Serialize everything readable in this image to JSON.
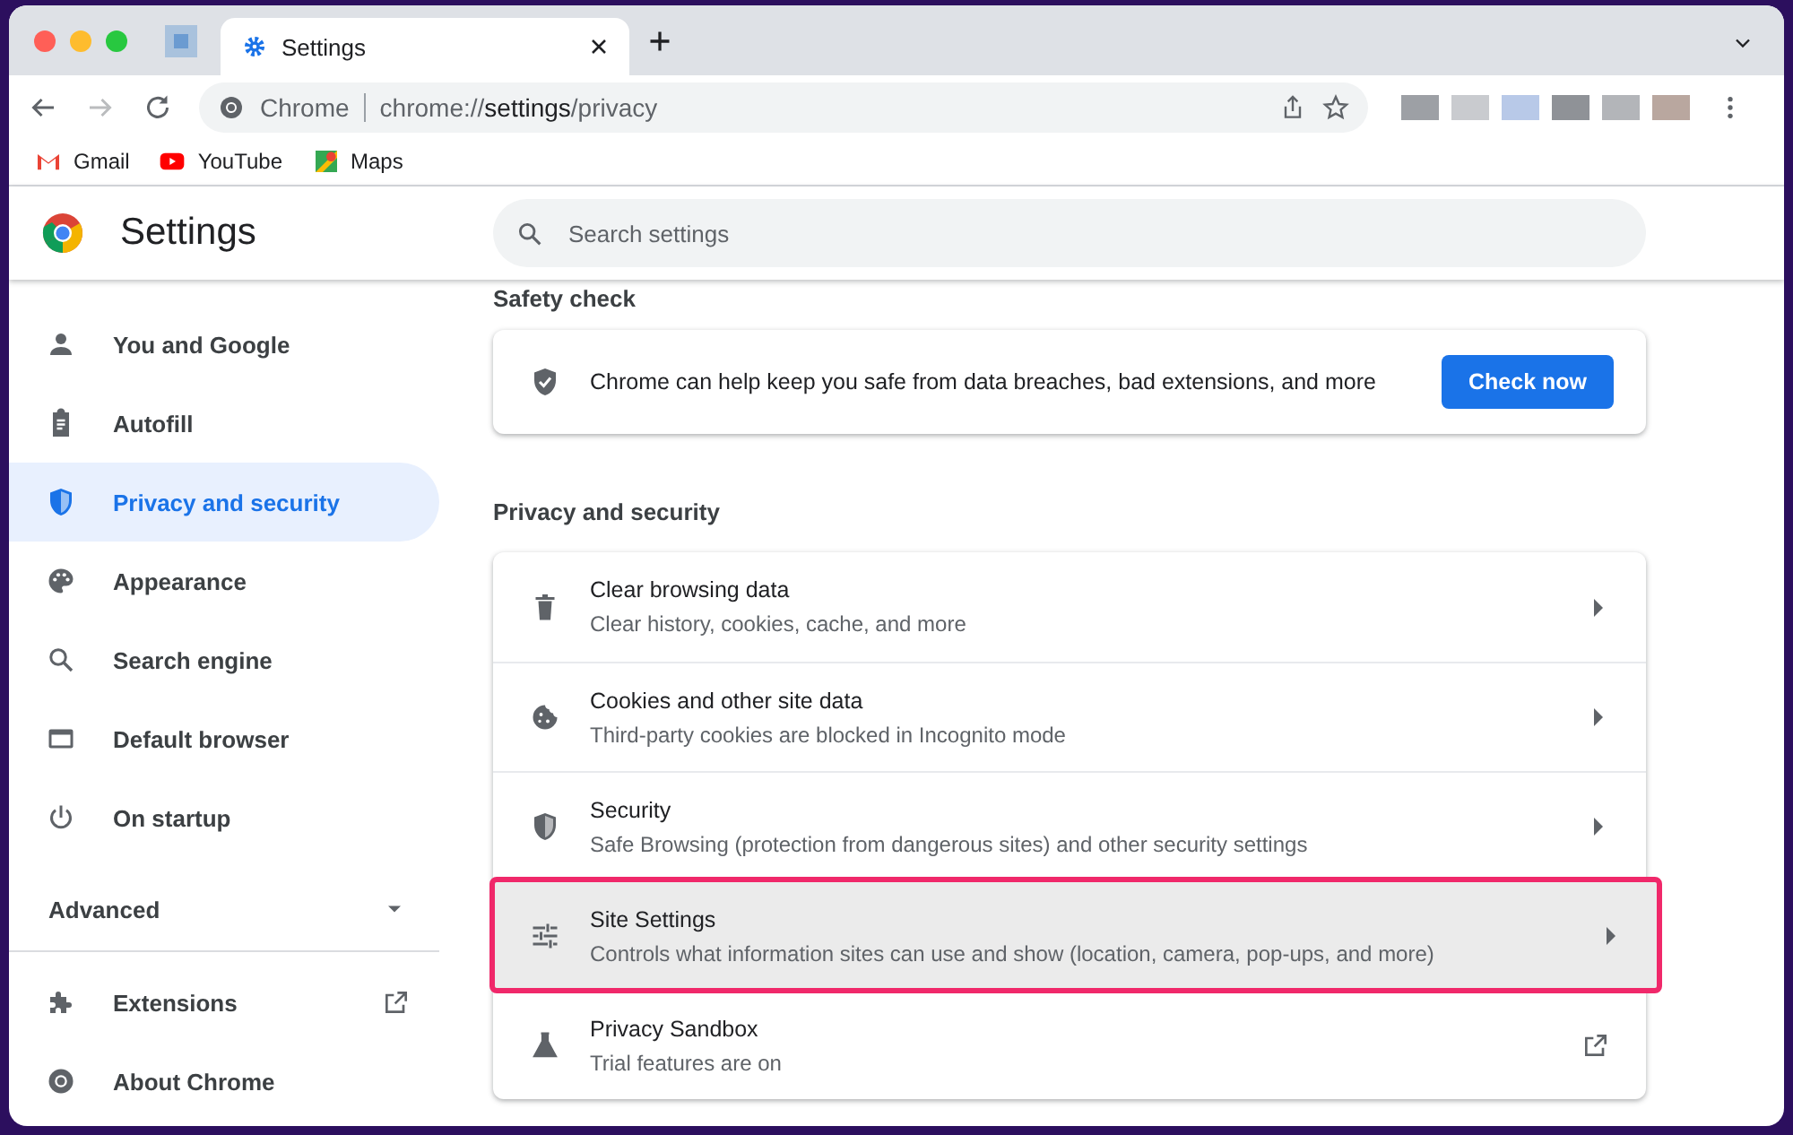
{
  "browser": {
    "tab": {
      "title": "Settings"
    },
    "omnibox": {
      "site_chip": "Chrome",
      "url": "chrome://**settings**/privacy"
    },
    "bookmarks": [
      {
        "label": "Gmail"
      },
      {
        "label": "YouTube"
      },
      {
        "label": "Maps"
      }
    ]
  },
  "header": {
    "title": "Settings",
    "search": {
      "placeholder": "Search settings"
    }
  },
  "sidebar": {
    "items": [
      {
        "label": "You and Google",
        "selected": false
      },
      {
        "label": "Autofill",
        "selected": false
      },
      {
        "label": "Privacy and security",
        "selected": true
      },
      {
        "label": "Appearance",
        "selected": false
      },
      {
        "label": "Search engine",
        "selected": false
      },
      {
        "label": "Default browser",
        "selected": false
      },
      {
        "label": "On startup",
        "selected": false
      }
    ],
    "advanced": {
      "label": "Advanced",
      "expanded": false
    },
    "extra_items": [
      {
        "label": "Extensions",
        "external": true
      },
      {
        "label": "About Chrome",
        "external": false
      }
    ]
  },
  "safety_check": {
    "title": "Safety check",
    "text": "Chrome can help keep you safe from data breaches, bad extensions, and more",
    "button": "Check now"
  },
  "privacy": {
    "title": "Privacy and security",
    "rows": [
      {
        "title": "Clear browsing data",
        "subtitle": "Clear history, cookies, cache, and more",
        "kind": "arrow",
        "highlighted": false
      },
      {
        "title": "Cookies and other site data",
        "subtitle": "Third-party cookies are blocked in Incognito mode",
        "kind": "arrow",
        "highlighted": false
      },
      {
        "title": "Security",
        "subtitle": "Safe Browsing (protection from dangerous sites) and other security settings",
        "kind": "arrow",
        "highlighted": false
      },
      {
        "title": "Site Settings",
        "subtitle": "Controls what information sites can use and show (location, camera, pop-ups, and more)",
        "kind": "arrow",
        "highlighted": true
      },
      {
        "title": "Privacy Sandbox",
        "subtitle": "Trial features are on",
        "kind": "external",
        "highlighted": false
      }
    ]
  }
}
